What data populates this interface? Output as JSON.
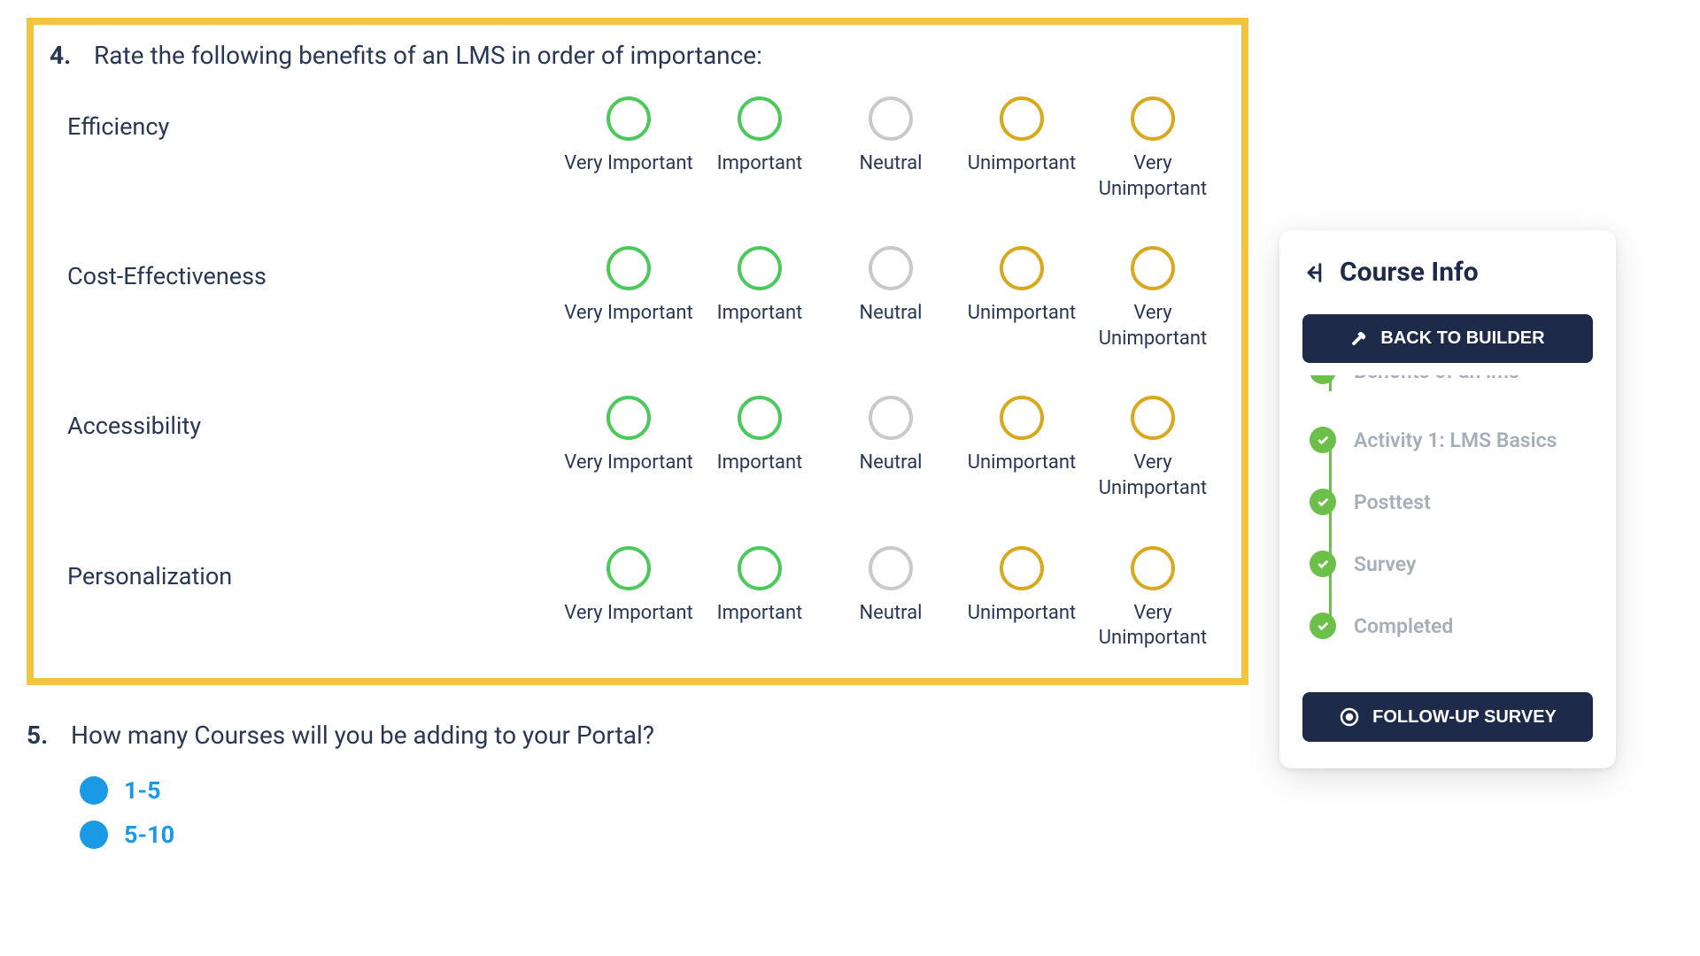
{
  "question4": {
    "number": "4.",
    "text": "Rate the following benefits of an LMS in order of importance:",
    "rows": [
      "Efficiency",
      "Cost-Effectiveness",
      "Accessibility",
      "Personalization"
    ],
    "options": [
      {
        "label": "Very Important",
        "color": "green"
      },
      {
        "label": "Important",
        "color": "green"
      },
      {
        "label": "Neutral",
        "color": "gray"
      },
      {
        "label": "Unimportant",
        "color": "amber"
      },
      {
        "label": "Very Unimportant",
        "color": "amber"
      }
    ]
  },
  "question5": {
    "number": "5.",
    "text": "How many Courses will you be adding to your Portal?",
    "options": [
      "1-5",
      "5-10"
    ]
  },
  "sidebar": {
    "title": "Course Info",
    "backToBuilder": "BACK TO BUILDER",
    "progress": [
      "Benefits of an lms",
      "Activity 1: LMS Basics",
      "Posttest",
      "Survey",
      "Completed"
    ],
    "followUp": "FOLLOW-UP SURVEY"
  }
}
